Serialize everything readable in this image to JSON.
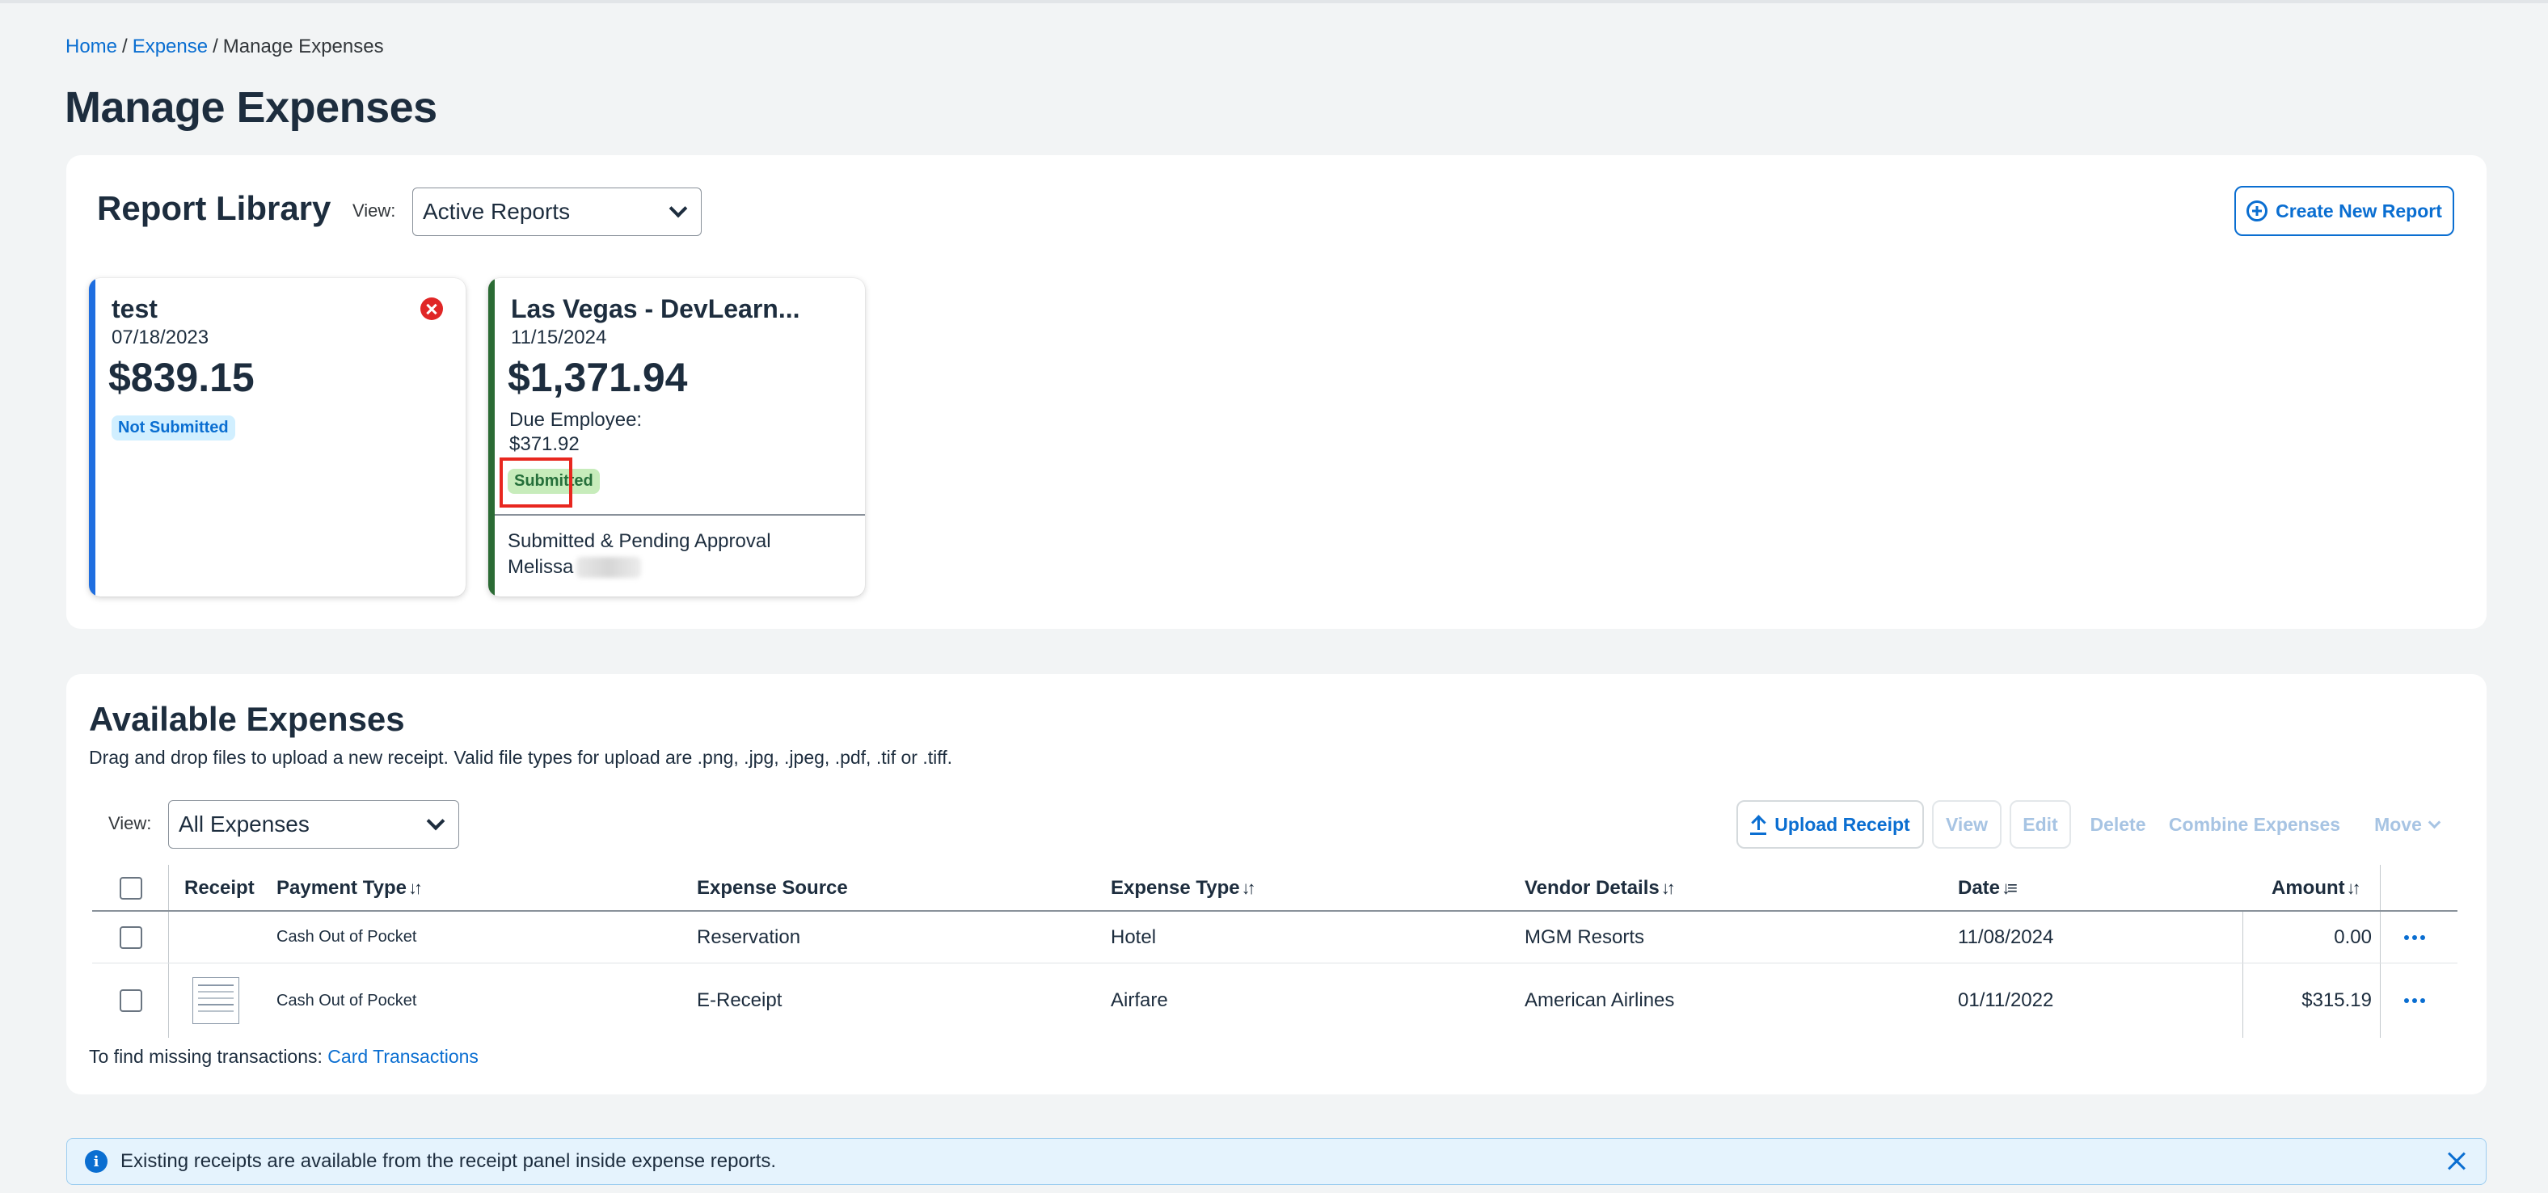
{
  "breadcrumb": {
    "home": "Home",
    "expense": "Expense",
    "current": "Manage Expenses",
    "separator": "/"
  },
  "page_title": "Manage Expenses",
  "report_library": {
    "title": "Report Library",
    "view_label": "View:",
    "view_value": "Active Reports",
    "create_button": "Create New Report",
    "cards": [
      {
        "name": "test",
        "date": "07/18/2023",
        "amount": "$839.15",
        "status": "Not Submitted",
        "accent_color": "#1f6ee0"
      },
      {
        "name": "Las Vegas - DevLearn...",
        "date": "11/15/2024",
        "amount": "$1,371.94",
        "due_label": "Due Employee:",
        "due_value": "$371.92",
        "status": "Submitted",
        "approval_status": "Submitted & Pending Approval",
        "approver": "Melissa",
        "accent_color": "#2b6b34"
      }
    ]
  },
  "available_expenses": {
    "title": "Available Expenses",
    "description": "Drag and drop files to upload a new receipt. Valid file types for upload are .png, .jpg, .jpeg, .pdf, .tif or .tiff.",
    "view_label": "View:",
    "view_value": "All Expenses",
    "toolbar": {
      "upload": "Upload Receipt",
      "view": "View",
      "edit": "Edit",
      "delete": "Delete",
      "combine": "Combine Expenses",
      "move": "Move"
    },
    "columns": {
      "receipt": "Receipt",
      "payment_type": "Payment Type",
      "expense_source": "Expense Source",
      "expense_type": "Expense Type",
      "vendor_details": "Vendor Details",
      "date": "Date",
      "amount": "Amount"
    },
    "rows": [
      {
        "payment_type": "Cash Out of Pocket",
        "expense_source": "Reservation",
        "expense_type": "Hotel",
        "vendor": "MGM Resorts",
        "date": "11/08/2024",
        "amount": "0.00",
        "has_receipt": false
      },
      {
        "payment_type": "Cash Out of Pocket",
        "expense_source": "E-Receipt",
        "expense_type": "Airfare",
        "vendor": "American Airlines",
        "date": "01/11/2022",
        "amount": "$315.19",
        "has_receipt": true
      }
    ],
    "footer_text": "To find missing transactions:",
    "footer_link": "Card Transactions"
  },
  "info_bar": {
    "icon": "i",
    "text": "Existing receipts are available from the receipt panel inside expense reports."
  }
}
